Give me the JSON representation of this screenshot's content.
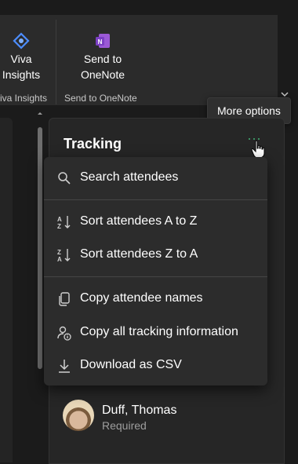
{
  "ribbon": {
    "viva_button_label_line1": "Viva",
    "viva_button_label_line2": "Insights",
    "viva_group_label": "iva Insights",
    "onenote_button_label_line1": "Send to",
    "onenote_button_label_line2": "OneNote",
    "onenote_group_label": "Send to OneNote",
    "collapse_glyph": "^"
  },
  "tooltip": {
    "text": "More options"
  },
  "tracking": {
    "title": "Tracking",
    "more_glyph": "···"
  },
  "menu": {
    "items": [
      {
        "label": "Search attendees",
        "icon": "search-icon"
      },
      {
        "label": "Sort attendees A to Z",
        "icon": "sort-a-z-icon"
      },
      {
        "label": "Sort attendees Z to A",
        "icon": "sort-z-a-icon"
      },
      {
        "label": "Copy attendee names",
        "icon": "copy-icon"
      },
      {
        "label": "Copy all tracking information",
        "icon": "copy-person-info-icon"
      },
      {
        "label": "Download as CSV",
        "icon": "download-icon"
      }
    ]
  },
  "attendee": {
    "name": "Duff, Thomas",
    "role": "Required"
  },
  "colors": {
    "accent_green": "#3fa36c",
    "viva_blue": "#4c8dff",
    "onenote_purple": "#7b3fc4"
  }
}
